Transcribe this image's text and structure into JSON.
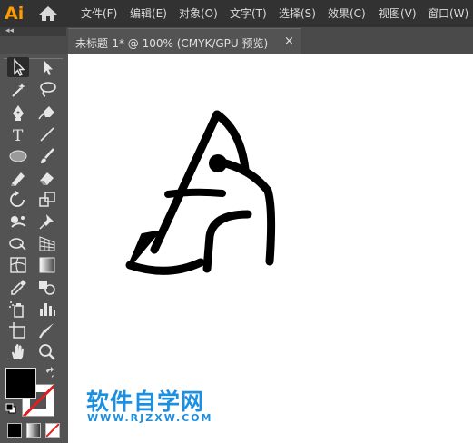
{
  "app": {
    "logo": "Ai"
  },
  "menu": [
    {
      "label": "文件(F)"
    },
    {
      "label": "编辑(E)"
    },
    {
      "label": "对象(O)"
    },
    {
      "label": "文字(T)"
    },
    {
      "label": "选择(S)"
    },
    {
      "label": "效果(C)"
    },
    {
      "label": "视图(V)"
    },
    {
      "label": "窗口(W)"
    }
  ],
  "panel": {
    "collapse_glyph": "◂◂"
  },
  "document_tab": {
    "title": "未标题-1* @ 100% (CMYK/GPU 预览)",
    "close": "×"
  },
  "tools": [
    "selection-tool",
    "direct-selection-tool",
    "magic-wand-tool",
    "lasso-tool",
    "pen-tool",
    "curvature-tool",
    "type-tool",
    "line-segment-tool",
    "ellipse-tool",
    "paintbrush-tool",
    "shaper-tool",
    "eraser-tool",
    "rotate-tool",
    "scale-tool",
    "puppet-warp-tool",
    "pin-tool",
    "free-transform-tool",
    "perspective-grid-tool",
    "mesh-tool",
    "gradient-tool",
    "eyedropper-tool",
    "blend-tool",
    "symbol-sprayer-tool",
    "column-graph-tool",
    "artboard-tool",
    "knife-tool",
    "hand-tool",
    "zoom-tool"
  ],
  "colors": {
    "fill": "#000000",
    "stroke": "none",
    "accent": "#ff9a00",
    "watermark": "#1d8fe0"
  },
  "watermark": {
    "title": "软件自学网",
    "url": "WWW.RJZXW.COM"
  }
}
